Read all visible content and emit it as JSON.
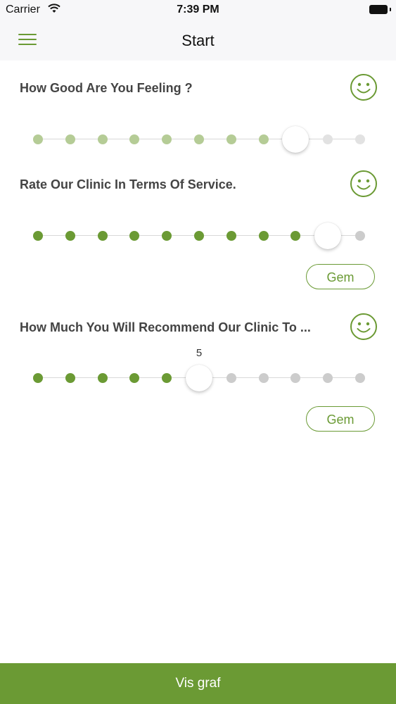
{
  "status_bar": {
    "carrier": "Carrier",
    "time": "7:39 PM",
    "icons": [
      "wifi-icon",
      "battery-icon"
    ]
  },
  "navbar": {
    "title": "Start",
    "menu_icon": "hamburger-menu-icon"
  },
  "colors": {
    "accent": "#6b9a34",
    "dot_active": "#6b9a34",
    "dot_faded": "#b5cc96",
    "dot_inactive": "#cccccc",
    "dot_very_light": "#e2e2e2",
    "track": "#d9d9d9"
  },
  "questions": [
    {
      "label": "How Good Are You Feeling ?",
      "icon": "smiley-icon",
      "steps": 11,
      "value": 8,
      "value_label": "",
      "has_save": false,
      "style": "faded"
    },
    {
      "label": "Rate Our Clinic In Terms Of Service.",
      "icon": "smiley-icon",
      "steps": 11,
      "value": 9,
      "value_label": "",
      "has_save": true,
      "save_label": "Gem",
      "style": "active"
    },
    {
      "label": "How Much You Will Recommend Our Clinic To ...",
      "icon": "smiley-icon",
      "steps": 11,
      "value": 5,
      "value_label": "5",
      "has_save": true,
      "save_label": "Gem",
      "style": "active"
    }
  ],
  "footer": {
    "button_label": "Vis graf"
  }
}
